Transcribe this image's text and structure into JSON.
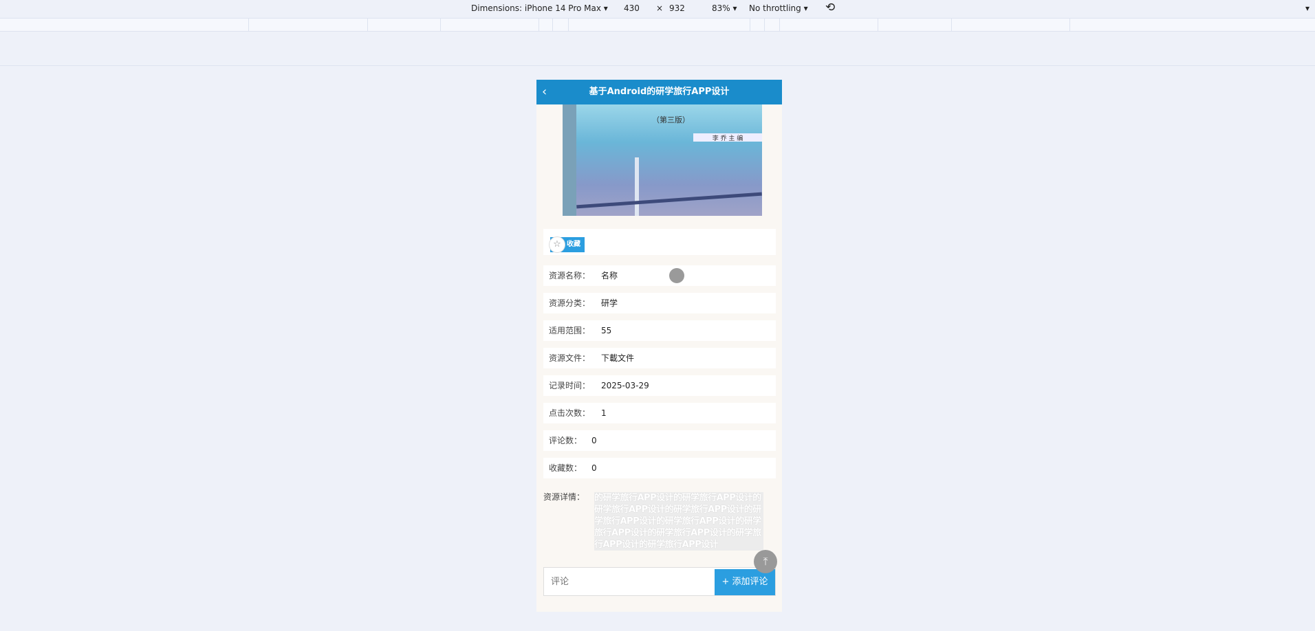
{
  "devtools": {
    "dimensions": "Dimensions: iPhone 14 Pro Max ▾",
    "width": "430",
    "times": "×",
    "height": "932",
    "zoom": "83% ▾",
    "throttling": "No throttling ▾",
    "rotate_icon": "rotate-icon",
    "more": "▾"
  },
  "header": {
    "title": "基于Android的研学旅行APP设计",
    "back": "‹"
  },
  "cover": {
    "edition": "（第三版）",
    "author": "李 乔 主 编"
  },
  "favorite": {
    "label": "收藏",
    "icon": "☆"
  },
  "fields": [
    {
      "label": "资源名称：",
      "value": "名称"
    },
    {
      "label": "资源分类：",
      "value": "研学"
    },
    {
      "label": "适用范围：",
      "value": "55"
    },
    {
      "label": "资源文件：",
      "value": "下載文件"
    },
    {
      "label": "记录时间：",
      "value": "2025-03-29"
    },
    {
      "label": "点击次数：",
      "value": "1"
    },
    {
      "label": "评论数：",
      "value": "0"
    },
    {
      "label": "收藏数：",
      "value": "0"
    }
  ],
  "details": {
    "label": "资源详情：",
    "text": "的研学旅行APP设计的研学旅行APP设计的研学旅行APP设计的研学旅行APP设计的研学旅行APP设计的研学旅行APP设计的研学旅行APP设计的研学旅行APP设计的研学旅行APP设计的研学旅行APP设计"
  },
  "comment": {
    "placeholder": "评论",
    "add_label": "+ 添加评论"
  },
  "back_to_top": "⤒"
}
